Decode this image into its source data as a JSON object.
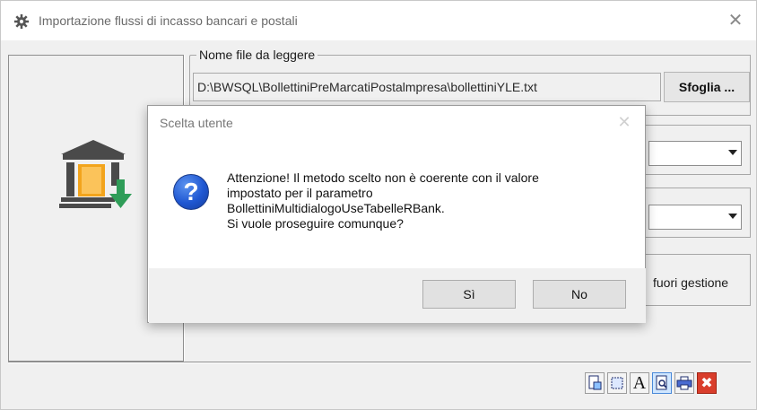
{
  "window": {
    "title": "Importazione flussi di incasso bancari e postali",
    "close_glyph": "✕"
  },
  "file_group": {
    "legend": "Nome file da leggere",
    "path_value": "D:\\BWSQL\\BollettiniPreMarcatiPostalmpresa\\bollettiniYLE.txt",
    "browse_label": "Sfoglia ..."
  },
  "right_panel": {
    "checkbox_label": "fuori gestione"
  },
  "toolbar": {
    "buttons": [
      {
        "name": "print-preview-icon"
      },
      {
        "name": "select-area-icon"
      },
      {
        "name": "font-icon",
        "text": "A"
      },
      {
        "name": "zoom-page-icon"
      },
      {
        "name": "printer-icon"
      },
      {
        "name": "close-red-icon",
        "text": "✖"
      }
    ]
  },
  "dialog": {
    "title": "Scelta utente",
    "close_glyph": "✕",
    "icon": "question-icon",
    "icon_text": "?",
    "message_lines": [
      "Attenzione! Il metodo scelto non è coerente con il valore",
      "impostato per il parametro",
      "BollettiniMultidialogoUseTabelleRBank.",
      "Si vuole proseguire comunque?"
    ],
    "yes_label": "Sì",
    "no_label": "No"
  },
  "colors": {
    "question_icon": "#1f57d2",
    "close_button": "#d93e2c",
    "window_bg": "#f0f0f0"
  }
}
